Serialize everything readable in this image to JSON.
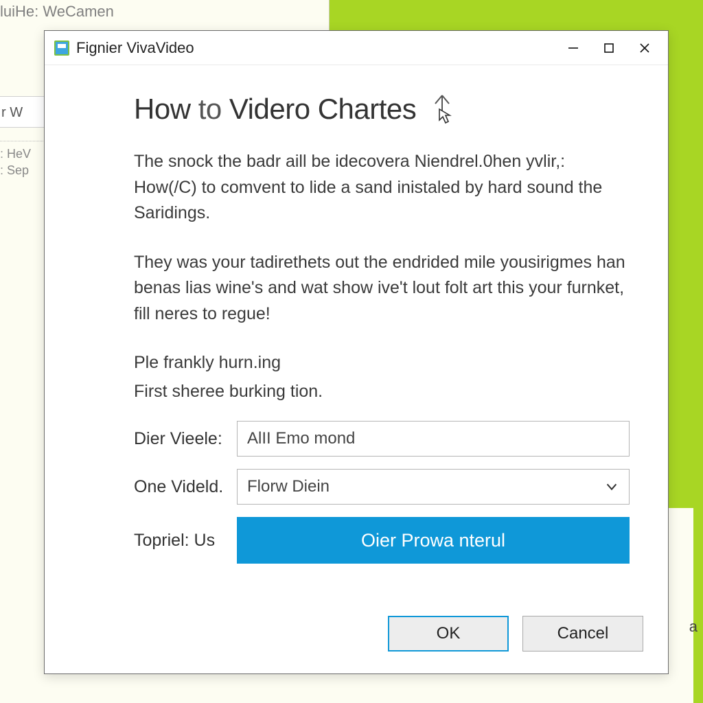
{
  "background": {
    "title": "luiHe: WeCamen",
    "tab_label": "r W",
    "list_items": [
      "HeV",
      "Sep"
    ],
    "right_char": "a"
  },
  "dialog": {
    "titlebar": {
      "app_name": "Fignier VivaVideo"
    },
    "heading_prefix": "How",
    "heading_to": "to",
    "heading_rest": "Videro Chartes",
    "paragraph1": "The snock the badr aill be idecovera Niendrel.0hen yvlir,: How(/C) to comvent to lide a sand inistaled by hard sound the Saridings.",
    "paragraph2": "They was your tadirethets out the endrided mile yousirigmes han benas lias wine's and wat show ive't lout folt art this your furnket, fill neres to regue!",
    "subline1": "Ple frankly hurn.ing",
    "subline2": "First sheree burking tion.",
    "fields": {
      "field1_label": "Dier Vieele:",
      "field1_value": "AlII Emo mond",
      "field2_label": "One Videld.",
      "field2_value": "Florw Diein",
      "action_label": "Topriel: Us",
      "primary_button": "Oier Prowa nterul"
    },
    "footer": {
      "ok": "OK",
      "cancel": "Cancel"
    }
  }
}
